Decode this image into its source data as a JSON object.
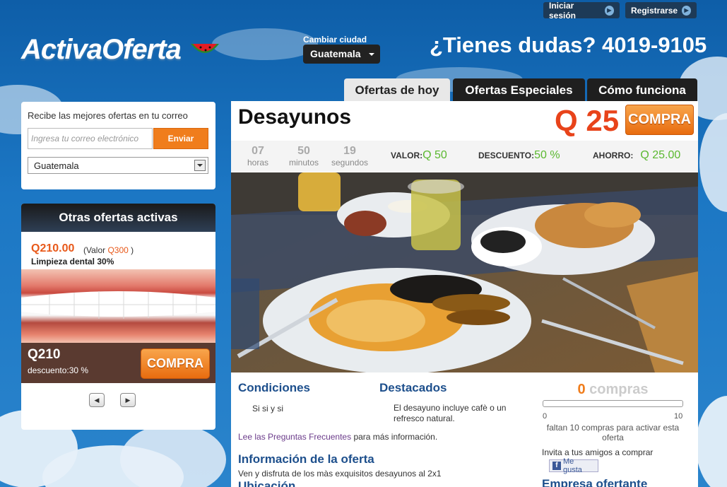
{
  "header": {
    "login_label": "Iniciar sesión",
    "register_label": "Registrarse",
    "logo_text": "ActivaOferta",
    "change_city_label": "Cambiar ciudad",
    "city_selected": "Guatemala",
    "help_text": "¿Tienes dudas? 4019-9105"
  },
  "tabs": [
    {
      "label": "Ofertas de hoy",
      "active": true
    },
    {
      "label": "Ofertas Especiales",
      "active": false
    },
    {
      "label": "Cómo funciona",
      "active": false
    }
  ],
  "subscribe": {
    "title": "Recibe las mejores ofertas en tu correo",
    "email_placeholder": "Ingresa tu correo electrónico",
    "send_label": "Enviar",
    "city_value": "Guatemala"
  },
  "other_offers": {
    "heading": "Otras ofertas activas",
    "price": "Q210.00",
    "value_prefix": "(Valor ",
    "value_amount": "Q300",
    "value_suffix": " )",
    "name": "Limpieza dental 30%",
    "card_price": "Q210",
    "discount_label": "descuento:",
    "discount_value": "30 %",
    "buy_label": "COMPRA",
    "prev_icon": "arrow-left-icon",
    "next_icon": "arrow-right-icon"
  },
  "deal": {
    "title": "Desayunos",
    "price": "Q 25",
    "buy_label": "COMPRA",
    "timer": [
      {
        "value": "07",
        "unit": "horas"
      },
      {
        "value": "50",
        "unit": "minutos"
      },
      {
        "value": "19",
        "unit": "segundos"
      }
    ],
    "valor_label": "VALOR:",
    "valor_value": "Q 50",
    "descuento_label": "DESCUENTO:",
    "descuento_value": "50 %",
    "ahorro_label": "AHORRO:",
    "ahorro_value": "Q 25.00"
  },
  "details": {
    "conditions_title": "Condiciones",
    "conditions_text": "Si si y si",
    "highlights_title": "Destacados",
    "highlights_text": "El desayuno incluye cafè o un refresco natural.",
    "faq_link": "Lee las Preguntas Frecuentes",
    "faq_suffix": " para más información.",
    "info_title": "Información de la oferta",
    "info_text": "Ven y disfruta de los màs exquisitos desayunos al 2x1",
    "location_title": "Ubicación"
  },
  "purchases": {
    "count": "0",
    "count_label": " compras",
    "min": "0",
    "max": "10",
    "progress": 0,
    "missing_text": "faltan 10 compras para activar esta oferta",
    "invite_text": "Invita a tus amigos a comprar",
    "like_label": "Me gusta",
    "company_title": "Empresa ofertante"
  },
  "colors": {
    "accent": "#f07d1c",
    "price": "#e8431a",
    "green": "#5bb830",
    "link": "#1d4f8c"
  }
}
